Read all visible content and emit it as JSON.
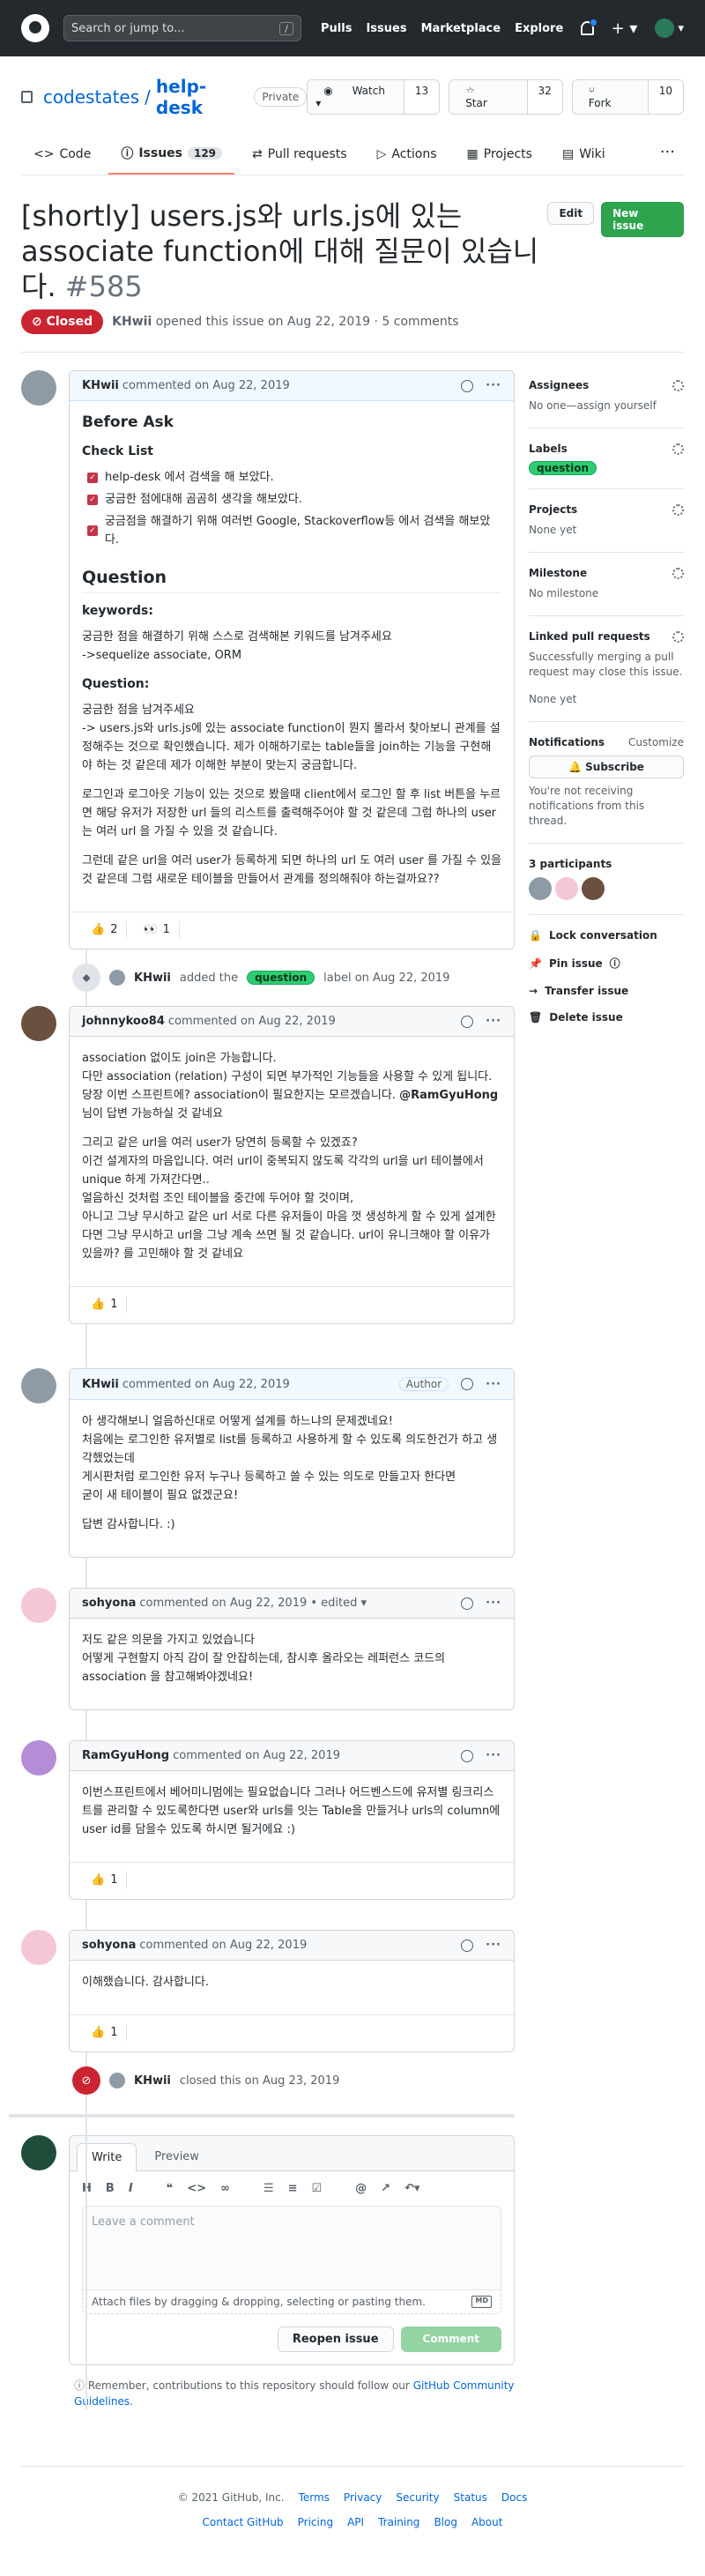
{
  "header": {
    "search_placeholder": "Search or jump to...",
    "slash": "/",
    "nav": [
      "Pulls",
      "Issues",
      "Marketplace",
      "Explore"
    ]
  },
  "repo": {
    "owner": "codestates",
    "sep": "/",
    "name": "help-desk",
    "visibility": "Private",
    "watch": {
      "label": "Watch",
      "count": "13"
    },
    "star": {
      "label": "Star",
      "count": "32"
    },
    "fork": {
      "label": "Fork",
      "count": "10"
    }
  },
  "tabs": {
    "code": "Code",
    "issues": "Issues",
    "issues_count": "129",
    "pulls": "Pull requests",
    "actions": "Actions",
    "projects": "Projects",
    "wiki": "Wiki"
  },
  "issue": {
    "title": "[shortly] users.js와 urls.js에 있는 associate function에 대해 질문이 있습니다.",
    "number": "#585",
    "edit": "Edit",
    "new_issue": "New issue",
    "state": "Closed",
    "author": "KHwii",
    "meta": "opened this issue on Aug 22, 2019 · 5 comments"
  },
  "c1": {
    "author": "KHwii",
    "meta": "commented on Aug 22, 2019",
    "h_before": "Before Ask",
    "h_checklist": "Check List",
    "checks": [
      "help-desk 에서 검색을 해 보았다.",
      "궁금한 점에대해 곰곰히 생각을 해보았다.",
      "궁금점을 해결하기 위해 여러번 Google, Stackoverflow등 에서 검색을 해보았다."
    ],
    "h_question": "Question",
    "h_keywords": "keywords:",
    "kw1": "궁금한 점을 해결하기 위해 스스로 검색해본 키워드를 남겨주세요",
    "kw2": "->sequelize associate, ORM",
    "h_q": "Question:",
    "q1": "궁금한 점을 남겨주세요",
    "q2": "-> users.js와 urls.js에 있는 associate function이 뭔지 몰라서 찾아보니 관계를 설정해주는 것으로 확인했습니다. 제가 이해하기로는 table들을 join하는 기능을 구현해야 하는 것 같은데 제가 이해한 부분이 맞는지 궁금합니다.",
    "q3": "로그인과 로그아웃 기능이 있는 것으로 봤을때 client에서 로그인 할 후 list 버튼을 누르면 해당 유저가 저장한 url 들의 리스트를 출력해주어야 할 것 같은데 그럼 하나의 user는 여러 url 을 가질 수 있을 것 같습니다.",
    "q4": "그런데 같은 url을 여러 user가 등록하게 되면 하나의 url 도 여러 user 를 가질 수 있을 것 같은데 그럼 새로운 테이블을 만들어서 관계를 정의해줘야 하는걸까요??",
    "r1": "2",
    "r2": "1"
  },
  "label_event": {
    "actor": "KHwii",
    "pre": "added the",
    "label": "question",
    "post": "label on Aug 22, 2019"
  },
  "c2": {
    "author": "johnnykoo84",
    "meta": "commented on Aug 22, 2019",
    "p1": "association 없이도 join은 가능합니다.",
    "p2": "다만 association (relation) 구성이 되면 부가적인 기능들을 사용할 수 있게 됩니다.",
    "p3a": "당장 이번 스프린트에? association이 필요한지는 모르겠습니다.",
    "p3b": "@RamGyuHong",
    "p3c": "님이 답변 가능하실 것 같네요",
    "p4": "그리고 같은 url을 여러 user가 당연히 등록할 수 있겠죠?",
    "p5": "이건 설계자의 마음입니다. 여러 url이 중복되지 않도록 각각의 url을 url 테이블에서 unique 하게 가져간다면..",
    "p6": "얼음하신 것처럼 조인 테이블을 중간에 두어야 할 것이며,",
    "p7": "아니고 그냥 무시하고 같은 url 서로 다른 유저들이 마음 껏 생성하게 할 수 있게 설계한다면 그냥 무시하고 url을 그냥 계속 쓰면 될 것 같습니다. url이 유니크해야 할 이유가 있을까? 를 고민해야 할 것 같네요",
    "r1": "1"
  },
  "c3": {
    "author": "KHwii",
    "meta": "commented on Aug 22, 2019",
    "badge": "Author",
    "p1": "아 생각해보니 얼음하신대로 어떻게 설계를 하느냐의 문제겠네요!",
    "p2": "처음에는 로그인한 유저별로 list를 등록하고 사용하게 할 수 있도록 의도한건가 하고 생각했었는데",
    "p3": "게시판처럼 로그인한 유저 누구나 등록하고 쓸 수 있는 의도로 만들고자 한다면",
    "p4": "굳이 새 테이블이 필요 없겠군요!",
    "p5": "답변 감사합니다. :)"
  },
  "c4": {
    "author": "sohyona",
    "meta": "commented on Aug 22, 2019 • edited",
    "p1": "저도 같은 의문을 가지고 있었습니다",
    "p2": "어떻게 구현할지 아직 감이 잘 안잡히는데, 참시후 올라오는 레퍼런스 코드의 association 을 참고해봐야겠네요!"
  },
  "c5": {
    "author": "RamGyuHong",
    "meta": "commented on Aug 22, 2019",
    "p1": "이번스프린트에서 베어미니멈에는 필요없습니다 그러나 어드벤스드에 유저별 링크리스트를 관리할 수 있도록한다면 user와 urls를 잇는 Table을 만들거나 urls의 column에 user id를 담을수 있도록 하시면 될거에요 :)",
    "r1": "1"
  },
  "c6": {
    "author": "sohyona",
    "meta": "commented on Aug 22, 2019",
    "p1": "이해했습니다. 감사합니다.",
    "r1": "1"
  },
  "close_event": {
    "actor": "KHwii",
    "text": "closed this on Aug 23, 2019"
  },
  "editor": {
    "write": "Write",
    "preview": "Preview",
    "placeholder": "Leave a comment",
    "attach": "Attach files by dragging & dropping, selecting or pasting them.",
    "md": "MD",
    "reopen": "Reopen issue",
    "comment": "Comment",
    "note_pre": "Remember, contributions to this repository should follow our",
    "note_link": "GitHub Community Guidelines",
    "note_post": "."
  },
  "sidebar": {
    "assignees": "Assignees",
    "assignees_val": "No one—assign yourself",
    "labels": "Labels",
    "label_val": "question",
    "projects": "Projects",
    "projects_val": "None yet",
    "milestone": "Milestone",
    "milestone_val": "No milestone",
    "linked": "Linked pull requests",
    "linked_desc": "Successfully merging a pull request may close this issue.",
    "linked_val": "None yet",
    "notifications": "Notifications",
    "customize": "Customize",
    "subscribe": "Subscribe",
    "notif_desc": "You're not receiving notifications from this thread.",
    "participants": "3 participants",
    "lock": "Lock conversation",
    "pin": "Pin issue",
    "transfer": "Transfer issue",
    "delete": "Delete issue"
  },
  "footer": {
    "copyright": "© 2021 GitHub, Inc.",
    "row1": [
      "Terms",
      "Privacy",
      "Security",
      "Status",
      "Docs"
    ],
    "row2": [
      "Contact GitHub",
      "Pricing",
      "API",
      "Training",
      "Blog",
      "About"
    ]
  },
  "colors": {
    "closed": "#cb2431",
    "label": "#2ecc71",
    "primary": "#2ea44f"
  }
}
